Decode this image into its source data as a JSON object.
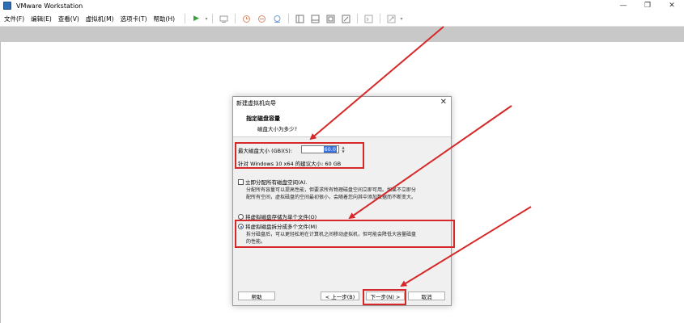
{
  "app": {
    "title": "VMware Workstation"
  },
  "window_controls": {
    "minimize": "—",
    "restore": "❐",
    "close": "✕"
  },
  "menu": [
    {
      "label": "文件(F)"
    },
    {
      "label": "编辑(E)"
    },
    {
      "label": "查看(V)"
    },
    {
      "label": "虚拟机(M)"
    },
    {
      "label": "选项卡(T)"
    },
    {
      "label": "帮助(H)"
    }
  ],
  "toolbar": {
    "icons": [
      "play-icon",
      "dropdown-icon",
      "send-keys-icon",
      "snapshot-icon",
      "revert-snapshot-icon",
      "snapshot-manager-icon",
      "sidebar-icon",
      "thumbnail-icon",
      "fullscreen-icon",
      "unity-icon",
      "console-icon",
      "stretch-icon"
    ]
  },
  "dialog": {
    "title": "新建虚拟机向导",
    "close": "✕",
    "header_title": "指定磁盘容量",
    "header_subtitle": "磁盘大小为多少?",
    "max_size_label": "最大磁盘大小 (GB)(S):",
    "max_size_value": "60.0",
    "recommended": "针对 Windows 10 x64 的建议大小: 60 GB",
    "allocate_label": "立即分配所有磁盘空间(A).",
    "allocate_checked": false,
    "allocate_desc_1": "分配所有容量可以提高性能，但要求所有物理磁盘空间立即可用。如果不立即分",
    "allocate_desc_2": "配所有空间，虚拟磁盘的空间最初很小，会随着您向其中添加数据而不断变大。",
    "single_file_label": "将虚拟磁盘存储为单个文件(O)",
    "multi_file_label": "将虚拟磁盘拆分成多个文件(M)",
    "multi_file_selected": true,
    "multi_desc_1": "拆分磁盘后，可以更轻松地在计算机之间移动虚拟机，但可能会降低大容量磁盘",
    "multi_desc_2": "的性能。",
    "buttons": {
      "help": "帮助",
      "back": "< 上一步(B)",
      "next": "下一步(N) >",
      "cancel": "取消"
    }
  },
  "colors": {
    "annotation_red": "#d62828",
    "selection_blue": "#3b6fd8",
    "tabstrip_gray": "#c8c8c8",
    "dialog_bg": "#f0f0f0"
  }
}
